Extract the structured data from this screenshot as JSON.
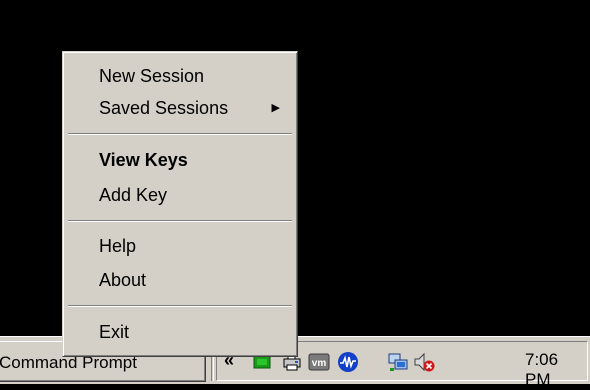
{
  "menu": {
    "items": [
      {
        "label": "New Session"
      },
      {
        "label": "Saved Sessions",
        "has_submenu": true
      },
      {
        "label": "View Keys",
        "bold": true
      },
      {
        "label": "Add Key"
      },
      {
        "label": "Help"
      },
      {
        "label": "About"
      },
      {
        "label": "Exit"
      }
    ],
    "submenu_arrow": "▶"
  },
  "taskbar": {
    "task_button_label": "Command Prompt",
    "chevron": "«",
    "tray_icons": [
      "green-chip-icon",
      "network-printer-icon",
      "vmware-icon",
      "waveform-icon",
      "network-computers-icon",
      "speaker-muted-icon"
    ],
    "vmware_icon_text": "vm",
    "clock": "7:06 PM"
  },
  "colors": {
    "desktop": "#000000",
    "menu_face": "#d4d0c8",
    "tray_green": "#1a9a1a",
    "waveform_blue": "#1240c8",
    "mute_red": "#d01818"
  }
}
